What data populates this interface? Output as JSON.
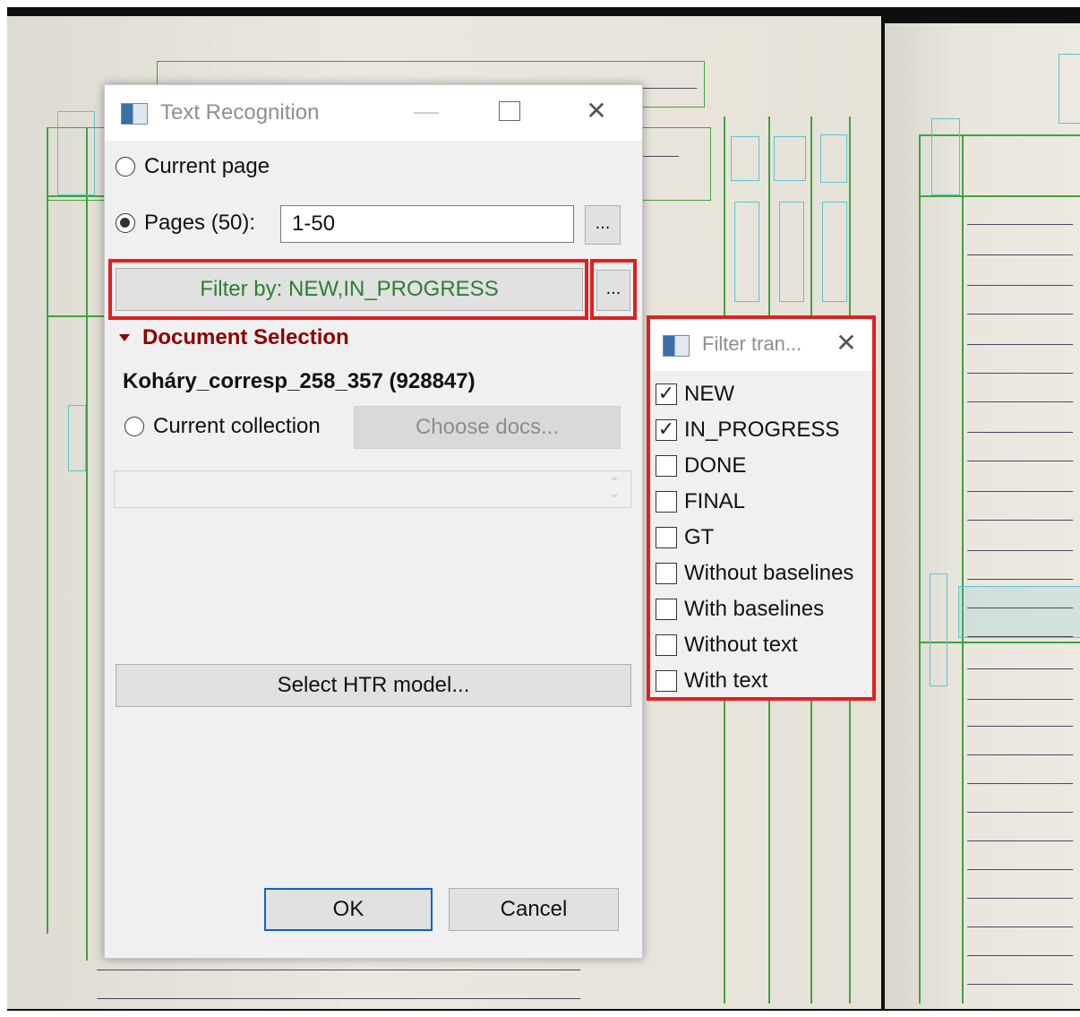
{
  "dialog": {
    "title": "Text Recognition",
    "current_page_label": "Current page",
    "pages_label": "Pages (50):",
    "pages_value": "1-50",
    "pages_browse_label": "...",
    "filter_button_label": "Filter by: NEW,IN_PROGRESS",
    "filter_more_label": "...",
    "doc_section_label": "Document Selection",
    "document_name": "Koháry_corresp_258_357 (928847)",
    "current_collection_label": "Current collection",
    "choose_docs_label": "Choose docs...",
    "select_model_label": "Select HTR model...",
    "ok_label": "OK",
    "cancel_label": "Cancel",
    "pages_selected": true,
    "current_page_selected": false,
    "current_collection_selected": false
  },
  "filter_popup": {
    "title": "Filter tran...",
    "options": [
      {
        "label": "NEW",
        "checked": true
      },
      {
        "label": "IN_PROGRESS",
        "checked": true
      },
      {
        "label": "DONE",
        "checked": false
      },
      {
        "label": "FINAL",
        "checked": false
      },
      {
        "label": "GT",
        "checked": false
      },
      {
        "label": "Without baselines",
        "checked": false
      },
      {
        "label": "With baselines",
        "checked": false
      },
      {
        "label": "Without text",
        "checked": false
      },
      {
        "label": "With text",
        "checked": false
      }
    ]
  },
  "colors": {
    "highlight": "#e02020",
    "filter_text": "#2e7d32",
    "section_text": "#8b0000",
    "ok_border": "#0a64c8"
  },
  "icons": [
    "app-icon",
    "minimize-icon",
    "maximize-icon",
    "close-icon",
    "triangle-down-icon",
    "spinner-icon"
  ]
}
